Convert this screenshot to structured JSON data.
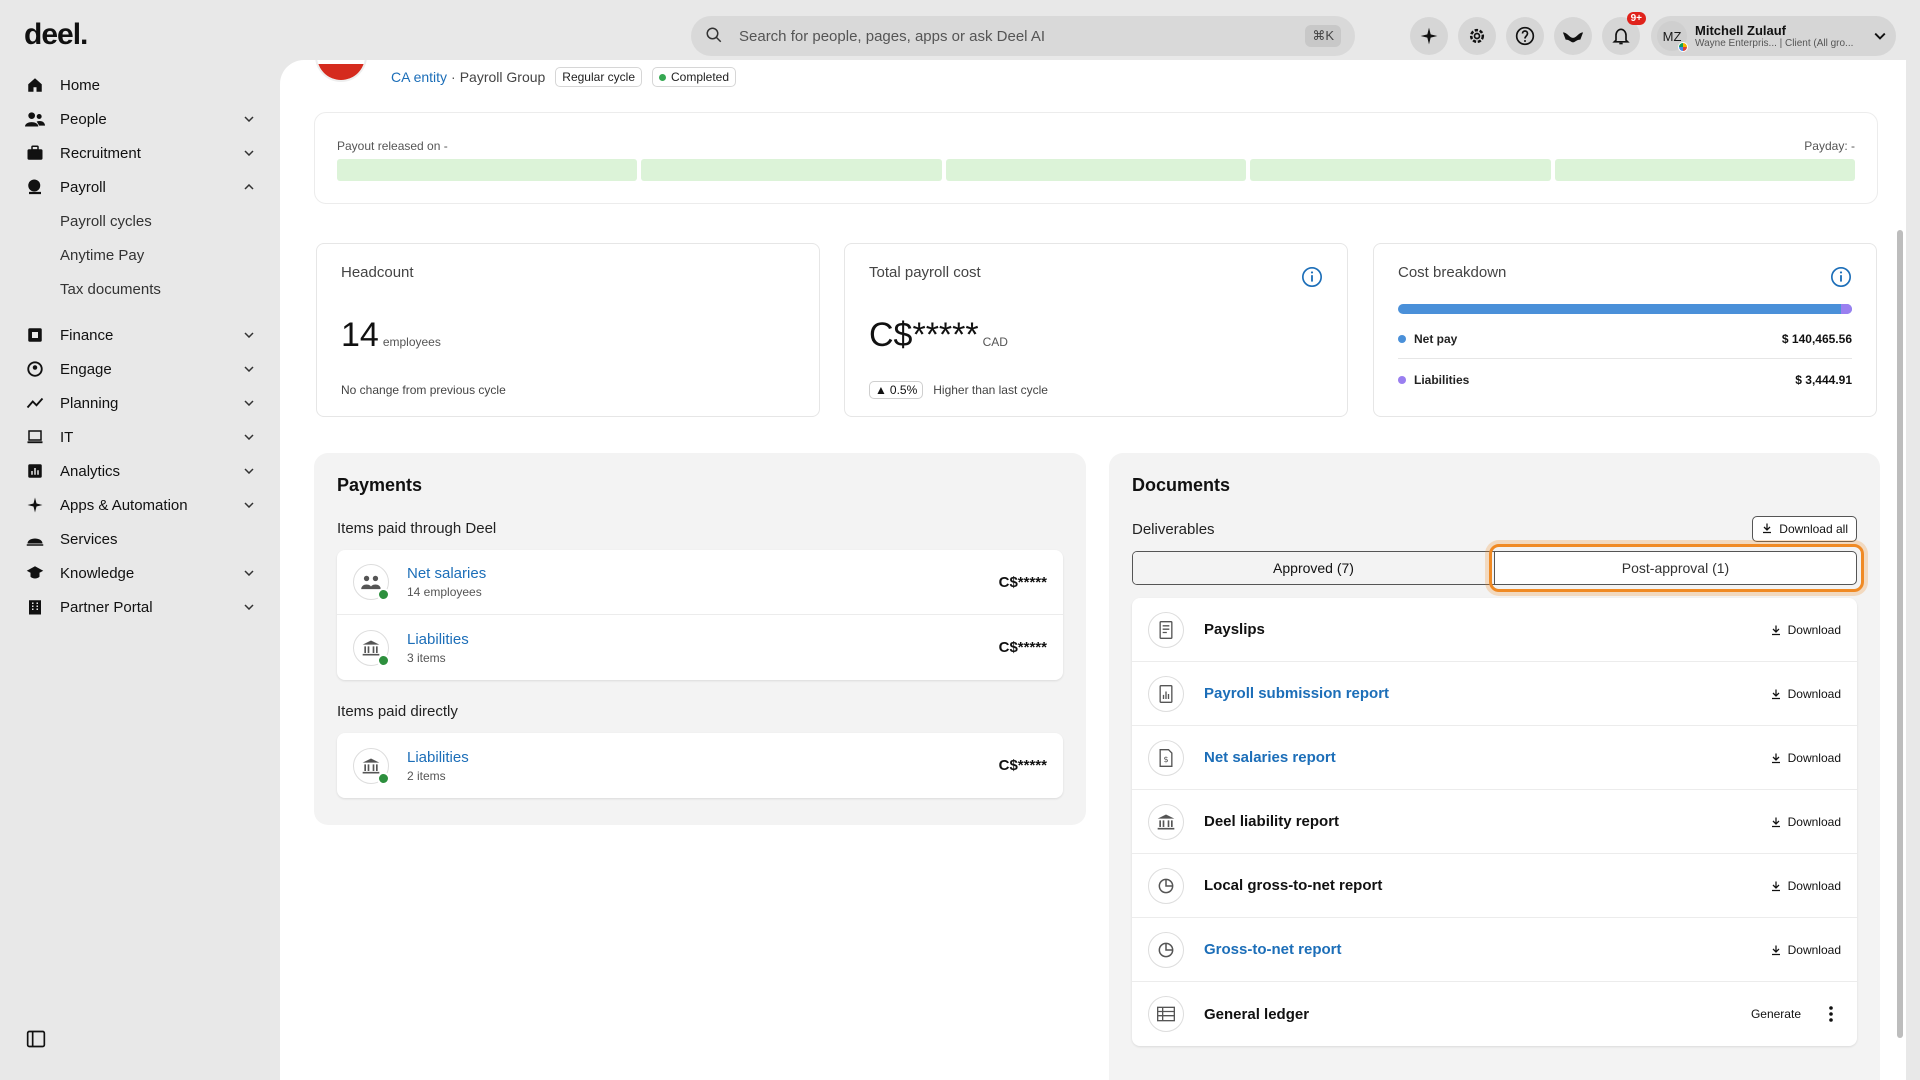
{
  "app": {
    "logo": "deel."
  },
  "sidebar": {
    "items": [
      {
        "label": "Home",
        "icon": "home-icon",
        "chevron": false
      },
      {
        "label": "People",
        "icon": "people-icon",
        "chevron": true
      },
      {
        "label": "Recruitment",
        "icon": "briefcase-icon",
        "chevron": true
      },
      {
        "label": "Payroll",
        "icon": "payroll-icon",
        "chevron": true,
        "expanded": true
      }
    ],
    "payroll_sub": [
      "Payroll cycles",
      "Anytime Pay",
      "Tax documents"
    ],
    "more_items": [
      {
        "label": "Finance",
        "icon": "finance-icon",
        "chevron": true
      },
      {
        "label": "Engage",
        "icon": "engage-icon",
        "chevron": true
      },
      {
        "label": "Planning",
        "icon": "planning-icon",
        "chevron": true
      },
      {
        "label": "IT",
        "icon": "laptop-icon",
        "chevron": true
      },
      {
        "label": "Analytics",
        "icon": "analytics-icon",
        "chevron": true
      },
      {
        "label": "Apps & Automation",
        "icon": "sparkle-icon",
        "chevron": true
      },
      {
        "label": "Services",
        "icon": "services-icon",
        "chevron": false
      },
      {
        "label": "Knowledge",
        "icon": "graduation-icon",
        "chevron": true
      },
      {
        "label": "Partner Portal",
        "icon": "building-icon",
        "chevron": true
      }
    ]
  },
  "topbar": {
    "search_placeholder": "Search for people, pages, apps or ask Deel AI",
    "shortcut": "⌘K",
    "notifications_badge": "9+",
    "user": {
      "initials": "MZ",
      "name": "Mitchell Zulauf",
      "subtitle": "Wayne Enterpris... | Client (All gro..."
    }
  },
  "header": {
    "entity": "CA entity",
    "separator": "·",
    "group": "Payroll Group",
    "cycle_chip": "Regular cycle",
    "status_chip": "Completed"
  },
  "payout": {
    "left": "Payout released on -",
    "right": "Payday: -",
    "segments": 5
  },
  "headcount": {
    "title": "Headcount",
    "value": "14",
    "unit": "employees",
    "footer": "No change from previous cycle"
  },
  "total_cost": {
    "title": "Total payroll cost",
    "value": "C$*****",
    "unit": "CAD",
    "delta": "0.5%",
    "delta_text": "Higher than last cycle"
  },
  "cost_breakdown": {
    "title": "Cost breakdown",
    "net_fraction": 0.976,
    "rows": [
      {
        "label": "Net pay",
        "value": "$ 140,465.56",
        "color": "#4a90d9"
      },
      {
        "label": "Liabilities",
        "value": "$ 3,444.91",
        "color": "#9a7ff0"
      }
    ]
  },
  "payments": {
    "title": "Payments",
    "through_deel_label": "Items paid through Deel",
    "through_deel": [
      {
        "title": "Net salaries",
        "sub": "14 employees",
        "amount": "C$*****"
      },
      {
        "title": "Liabilities",
        "sub": "3 items",
        "amount": "C$*****"
      }
    ],
    "direct_label": "Items paid directly",
    "direct": [
      {
        "title": "Liabilities",
        "sub": "2 items",
        "amount": "C$*****"
      }
    ]
  },
  "documents": {
    "title": "Documents",
    "deliverables_label": "Deliverables",
    "download_all": "Download all",
    "tabs": [
      "Approved (7)",
      "Post-approval (1)"
    ],
    "rows": [
      {
        "title": "Payslips",
        "link": false,
        "action": "Download"
      },
      {
        "title": "Payroll submission report",
        "link": true,
        "action": "Download"
      },
      {
        "title": "Net salaries report",
        "link": true,
        "action": "Download"
      },
      {
        "title": "Deel liability report",
        "link": false,
        "action": "Download"
      },
      {
        "title": "Local gross-to-net report",
        "link": false,
        "action": "Download"
      },
      {
        "title": "Gross-to-net report",
        "link": true,
        "action": "Download"
      },
      {
        "title": "General ledger",
        "link": false,
        "action": "Generate"
      }
    ]
  }
}
